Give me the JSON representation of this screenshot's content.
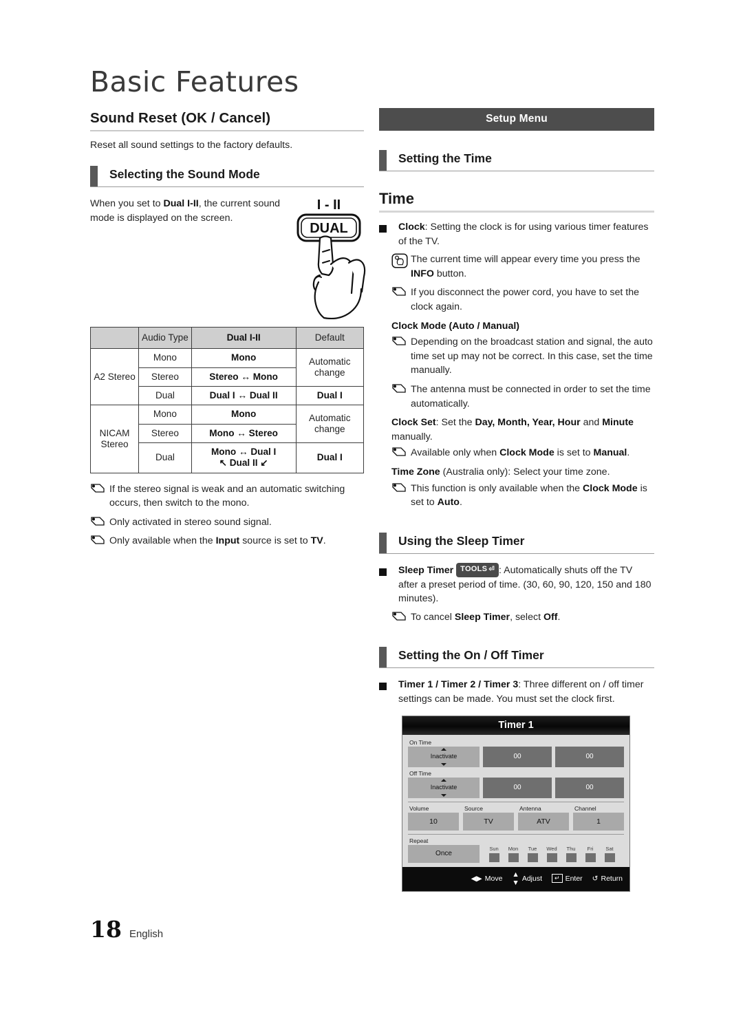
{
  "chapter": {
    "title": "Basic Features"
  },
  "left": {
    "sound_reset": {
      "heading": "Sound Reset (OK / Cancel)",
      "intro": "Reset all sound settings to the factory defaults."
    },
    "selecting_sound_mode": {
      "heading": "Selecting the Sound Mode",
      "figure_text_1": "When you set to ",
      "figure_text_bold": "Dual I-II",
      "figure_text_2": ", the current sound mode is displayed on the screen.",
      "remote_label_top": "I - II",
      "remote_button_label": "DUAL"
    },
    "audio_table": {
      "headers": [
        "",
        "Audio Type",
        "Dual I-II",
        "Default"
      ],
      "rows": [
        {
          "group": "A2 Stereo",
          "type": "Mono",
          "dual": "Mono",
          "default": "Automatic change"
        },
        {
          "group": "A2 Stereo",
          "type": "Stereo",
          "dual": "Stereo ↔ Mono",
          "default": "Automatic change"
        },
        {
          "group": "A2 Stereo",
          "type": "Dual",
          "dual": "Dual I ↔ Dual II",
          "default": "Dual I"
        },
        {
          "group": "NICAM Stereo",
          "type": "Mono",
          "dual": "Mono",
          "default": "Automatic change"
        },
        {
          "group": "NICAM Stereo",
          "type": "Stereo",
          "dual": "Mono ↔ Stereo",
          "default": "Automatic change"
        },
        {
          "group": "NICAM Stereo",
          "type": "Dual",
          "dual": "Mono ↔ Dual I",
          "dual2": "↖ Dual II ↙",
          "default": "Dual I"
        }
      ],
      "cells": {
        "group_a2": "A2 Stereo",
        "group_nicam": "NICAM Stereo",
        "h_audio_type": "Audio Type",
        "h_dual": "Dual I-II",
        "h_default": "Default",
        "mono": "Mono",
        "stereo": "Stereo",
        "dual": "Dual",
        "auto_change": "Automatic change",
        "dual_i": "Dual I",
        "v_mono": "Mono",
        "v_stereo_mono": "Stereo ↔ Mono",
        "v_dual_dual": "Dual I ↔ Dual II",
        "v_mono_stereo": "Mono ↔ Stereo",
        "v_mono_duali": "Mono ↔ Dual I",
        "v_dualii": "↖ Dual II ↙"
      }
    },
    "notes": [
      "If the stereo signal is weak and an automatic switching occurs, then switch to the mono.",
      "Only activated in stereo sound signal.",
      "Only available when the Input source is set to TV."
    ],
    "note3_parts": {
      "a": "Only available when the ",
      "b": "Input",
      "c": " source is set to ",
      "d": "TV",
      "e": "."
    }
  },
  "right": {
    "setup_menu_bar": "Setup Menu",
    "setting_the_time_heading": "Setting the Time",
    "time_heading": "Time",
    "clock_item": {
      "label": "Clock",
      "text": ": Setting the clock is for using various timer features of the TV."
    },
    "info_note": {
      "a": "The current time will appear every time you press the ",
      "b": "INFO",
      "c": " button."
    },
    "power_cord_note": "If you disconnect the power cord, you have to set the clock again.",
    "clock_mode_heading": "Clock Mode (Auto / Manual)",
    "clock_mode_note_1": "Depending on the broadcast station and signal, the auto time set up may not be correct. In this case, set the time manually.",
    "clock_mode_note_2": "The antenna must be connected in order to set the time automatically.",
    "clock_set": {
      "a": "Clock Set",
      "b": ": Set the ",
      "c": "Day, Month, Year, Hour",
      "d": " and ",
      "e": "Minute",
      "f": " manually."
    },
    "clock_set_note": {
      "a": "Available only when ",
      "b": "Clock Mode",
      "c": " is set to ",
      "d": "Manual",
      "e": "."
    },
    "time_zone": {
      "a": "Time Zone",
      "b": " (Australia only): Select your time zone."
    },
    "time_zone_note": {
      "a": "This function is only available when the ",
      "b": "Clock Mode",
      "c": " is set to ",
      "d": "Auto",
      "e": "."
    },
    "sleep_timer_heading": "Using the Sleep Timer",
    "sleep_timer_item": {
      "label": "Sleep Timer",
      "badge": "TOOLS",
      "text": ": Automatically shuts off the TV after a preset period of time. (30, 60, 90, 120, 150 and 180 minutes)."
    },
    "sleep_cancel_note": {
      "a": "To cancel ",
      "b": "Sleep Timer",
      "c": ", select ",
      "d": "Off",
      "e": "."
    },
    "on_off_timer_heading": "Setting the On / Off Timer",
    "timer_item": {
      "label": "Timer 1 / Timer 2 / Timer 3",
      "text": ": Three different on / off timer settings can be made. You must set the clock first."
    },
    "osd": {
      "title": "Timer 1",
      "on_time_label": "On Time",
      "off_time_label": "Off Time",
      "on_time": {
        "state": "Inactivate",
        "hour": "00",
        "minute": "00"
      },
      "off_time": {
        "state": "Inactivate",
        "hour": "00",
        "minute": "00"
      },
      "quad": [
        {
          "label": "Volume",
          "value": "10"
        },
        {
          "label": "Source",
          "value": "TV"
        },
        {
          "label": "Antenna",
          "value": "ATV"
        },
        {
          "label": "Channel",
          "value": "1"
        }
      ],
      "repeat_label": "Repeat",
      "repeat_value": "Once",
      "days": [
        "Sun",
        "Mon",
        "Tue",
        "Wed",
        "Thu",
        "Fri",
        "Sat"
      ],
      "footer": [
        {
          "icon": "left-right-arrows-icon",
          "label": "Move"
        },
        {
          "icon": "up-down-arrows-icon",
          "label": "Adjust"
        },
        {
          "icon": "enter-key-icon",
          "label": "Enter"
        },
        {
          "icon": "return-arrow-icon",
          "label": "Return"
        }
      ]
    }
  },
  "footer": {
    "page_number": "18",
    "language": "English"
  },
  "colors": {
    "dark_bar": "#4d4d4d",
    "table_header": "#cfcfcf",
    "osd_panel": "#dcdcdc",
    "osd_cell": "#a9a9a9",
    "osd_cell_dark": "#6f6f6f"
  }
}
